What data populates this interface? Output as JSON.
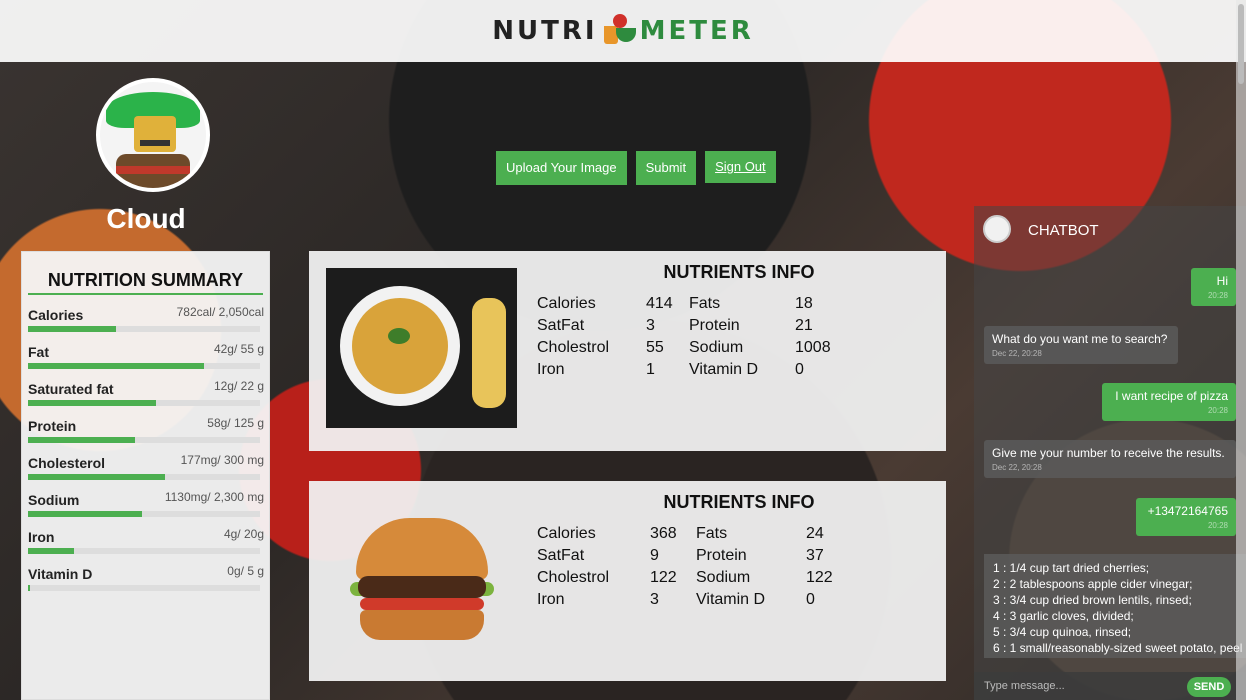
{
  "header": {
    "logo_left": "NUTRI",
    "logo_right": "METER"
  },
  "profile": {
    "username": "Cloud"
  },
  "actions": {
    "upload_label": "Upload Your Image",
    "submit_label": "Submit",
    "signout_label": "Sign Out"
  },
  "summary": {
    "title": "NUTRITION SUMMARY",
    "items": [
      {
        "label": "Calories",
        "value": "782cal/ 2,050cal",
        "progress": 0.38
      },
      {
        "label": "Fat",
        "value": "42g/ 55 g",
        "progress": 0.76
      },
      {
        "label": "Saturated fat",
        "value": "12g/ 22 g",
        "progress": 0.55
      },
      {
        "label": "Protein",
        "value": "58g/ 125 g",
        "progress": 0.46
      },
      {
        "label": "Cholesterol",
        "value": "177mg/ 300 mg",
        "progress": 0.59
      },
      {
        "label": "Sodium",
        "value": "1130mg/ 2,300 mg",
        "progress": 0.49
      },
      {
        "label": "Iron",
        "value": "4g/ 20g",
        "progress": 0.2
      },
      {
        "label": "Vitamin D",
        "value": "0g/ 5 g",
        "progress": 0.01
      }
    ]
  },
  "cards": [
    {
      "title": "NUTRIENTS INFO",
      "food": "soup",
      "rows": [
        [
          "Calories",
          "414",
          "Fats",
          "18"
        ],
        [
          "SatFat",
          "3",
          "Protein",
          "21"
        ],
        [
          "Cholestrol",
          "55",
          "Sodium",
          "1008"
        ],
        [
          "Iron",
          "1",
          "Vitamin D",
          "0"
        ]
      ]
    },
    {
      "title": "NUTRIENTS INFO",
      "food": "burger",
      "rows": [
        [
          "Calories",
          "368",
          "Fats",
          "24"
        ],
        [
          "SatFat",
          "9",
          "Protein",
          "37"
        ],
        [
          "Cholestrol",
          "122",
          "Sodium",
          "122"
        ],
        [
          "Iron",
          "3",
          "Vitamin D",
          "0"
        ]
      ]
    }
  ],
  "chat": {
    "title": "CHATBOT",
    "messages": [
      {
        "dir": "out",
        "text": "Hi",
        "time": "20:28"
      },
      {
        "dir": "in",
        "text": "What do you want me to search?",
        "time": "Dec 22, 20:28"
      },
      {
        "dir": "out",
        "text": "I want recipe of pizza",
        "time": "20:28"
      },
      {
        "dir": "in",
        "text": "Give me your number to receive the results.",
        "time": "Dec 22, 20:28"
      },
      {
        "dir": "out",
        "text": "+13472164765",
        "time": "20:28"
      }
    ],
    "recipe_lines": [
      "1 : 1/4 cup tart dried cherries;",
      "2 : 2 tablespoons apple cider vinegar;",
      "3 : 3/4 cup dried brown lentils, rinsed;",
      "4 : 3 garlic cloves, divided;",
      "5 : 3/4 cup quinoa, rinsed;",
      "6 : 1 small/reasonably-sized sweet potato, peel"
    ],
    "input_placeholder": "Type message...",
    "send_label": "SEND"
  }
}
